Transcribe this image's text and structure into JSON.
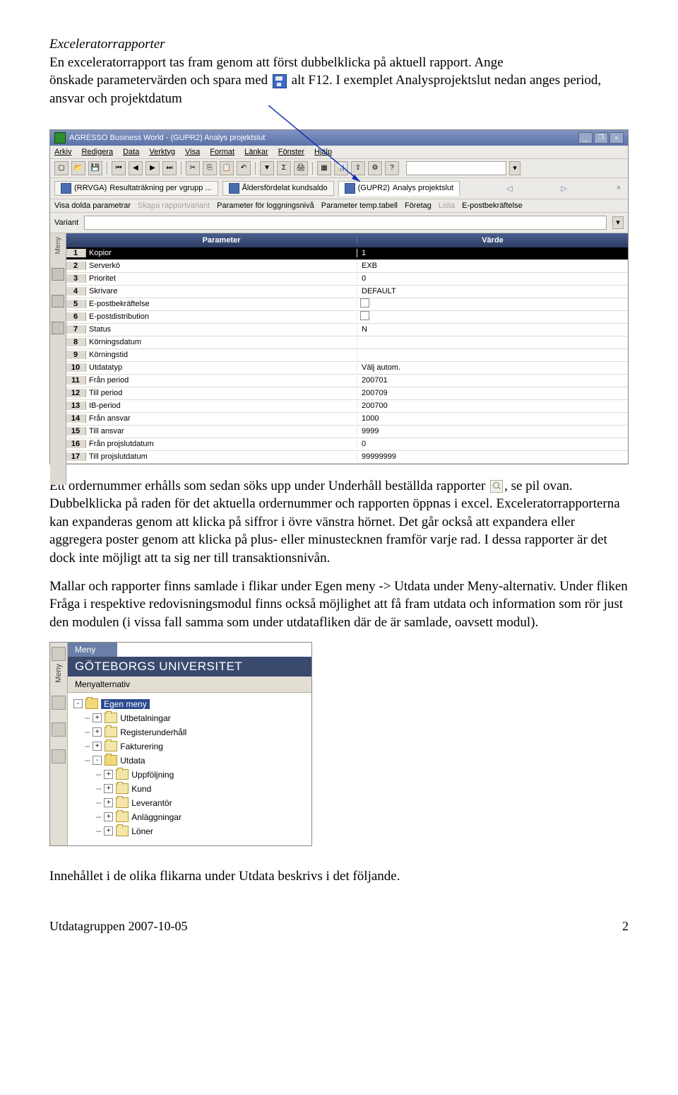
{
  "intro": {
    "heading": "Exceleratorrapporter",
    "p1a": "En exceleratorrapport tas fram genom att först dubbelklicka på aktuell rapport. Ange",
    "p1b": "önskade parametervärden och spara med",
    "p1c": "alt F12. I exemplet Analysprojektslut nedan anges period, ansvar och projektdatum"
  },
  "app": {
    "title": "AGRESSO Business World - (GUPR2) Analys projektslut",
    "winbtns": {
      "min": "_",
      "max": "❐",
      "close": "×"
    },
    "menu": [
      "Arkiv",
      "Redigera",
      "Data",
      "Verktyg",
      "Visa",
      "Format",
      "Länkar",
      "Fönster",
      "Hjälp"
    ],
    "tabs": [
      {
        "code": "(RRVGA)",
        "label": "Resultaträkning per vgrupp ..."
      },
      {
        "code": "",
        "label": "Åldersfördelat kundsaldo"
      },
      {
        "code": "(GUPR2)",
        "label": "Analys projektslut"
      }
    ],
    "subtoolbar": {
      "a": "Visa dolda parametrar",
      "b": "Skapa rapportvariant",
      "c": "Parameter för loggningsnivå",
      "d": "Parameter temp.tabell",
      "e": "Företag",
      "f": "Lista",
      "g": "E-postbekräftelse"
    },
    "variant_label": "Variant",
    "grid": {
      "head_param": "Parameter",
      "head_value": "Värde",
      "rows": [
        {
          "n": "1",
          "p": "Kopior",
          "v": "1",
          "sel": true,
          "type": "text"
        },
        {
          "n": "2",
          "p": "Serverkö",
          "v": "EXB",
          "type": "text"
        },
        {
          "n": "3",
          "p": "Prioritet",
          "v": "0",
          "type": "text"
        },
        {
          "n": "4",
          "p": "Skrivare",
          "v": "DEFAULT",
          "type": "text"
        },
        {
          "n": "5",
          "p": "E-postbekräftelse",
          "v": "",
          "type": "check"
        },
        {
          "n": "6",
          "p": "E-postdistribution",
          "v": "",
          "type": "check"
        },
        {
          "n": "7",
          "p": "Status",
          "v": "N",
          "type": "text"
        },
        {
          "n": "8",
          "p": "Körningsdatum",
          "v": "",
          "type": "text"
        },
        {
          "n": "9",
          "p": "Körningstid",
          "v": "",
          "type": "text"
        },
        {
          "n": "10",
          "p": "Utdatatyp",
          "v": "Välj autom.",
          "type": "text"
        },
        {
          "n": "11",
          "p": "Från period",
          "v": "200701",
          "type": "text"
        },
        {
          "n": "12",
          "p": "Till period",
          "v": "200709",
          "type": "text"
        },
        {
          "n": "13",
          "p": "IB-period",
          "v": "200700",
          "type": "text"
        },
        {
          "n": "14",
          "p": "Från ansvar",
          "v": "1000",
          "type": "text"
        },
        {
          "n": "15",
          "p": "Till ansvar",
          "v": "9999",
          "type": "text"
        },
        {
          "n": "16",
          "p": "Från projslutdatum",
          "v": "0",
          "type": "text"
        },
        {
          "n": "17",
          "p": "Till projslutdatum",
          "v": "99999999",
          "type": "text"
        }
      ]
    }
  },
  "body": {
    "p2a": "Ett ordernummer erhålls som sedan söks upp under Underhåll beställda rapporter",
    "p2b": ", se pil ovan. Dubbelklicka på raden för det aktuella ordernummer och rapporten öppnas i excel. Exceleratorrapporterna kan expanderas genom att klicka på siffror i övre vänstra hörnet. Det går också att expandera eller aggregera poster genom att klicka på plus- eller minustecknen framför varje rad. I dessa rapporter är det dock inte möjligt att ta sig ner till transaktionsnivån.",
    "p3": "Mallar och rapporter finns samlade i flikar under Egen meny -> Utdata under Meny-alternativ. Under fliken Fråga i respektive redovisningsmodul finns också möjlighet att få fram utdata och information som rör just den modulen (i vissa fall samma som under utdatafliken där de är samlade, oavsett modul).",
    "p4": "Innehållet i de olika flikarna under Utdata beskrivs i det följande."
  },
  "menu2": {
    "tab": "Meny",
    "banner": "GÖTEBORGS UNIVERSITET",
    "label": "Menyalternativ",
    "tree": [
      {
        "lvl": 0,
        "exp": "-",
        "label": "Egen meny",
        "sel": true,
        "open": true
      },
      {
        "lvl": 1,
        "exp": "+",
        "label": "Utbetalningar"
      },
      {
        "lvl": 1,
        "exp": "+",
        "label": "Registerunderhåll"
      },
      {
        "lvl": 1,
        "exp": "+",
        "label": "Fakturering"
      },
      {
        "lvl": 1,
        "exp": "-",
        "label": "Utdata",
        "open": true
      },
      {
        "lvl": 2,
        "exp": "+",
        "label": "Uppföljning"
      },
      {
        "lvl": 2,
        "exp": "+",
        "label": "Kund"
      },
      {
        "lvl": 2,
        "exp": "+",
        "label": "Leverantör"
      },
      {
        "lvl": 2,
        "exp": "+",
        "label": "Anläggningar"
      },
      {
        "lvl": 2,
        "exp": "+",
        "label": "Löner"
      }
    ]
  },
  "footer": {
    "left": "Utdatagruppen 2007-10-05",
    "right": "2"
  }
}
